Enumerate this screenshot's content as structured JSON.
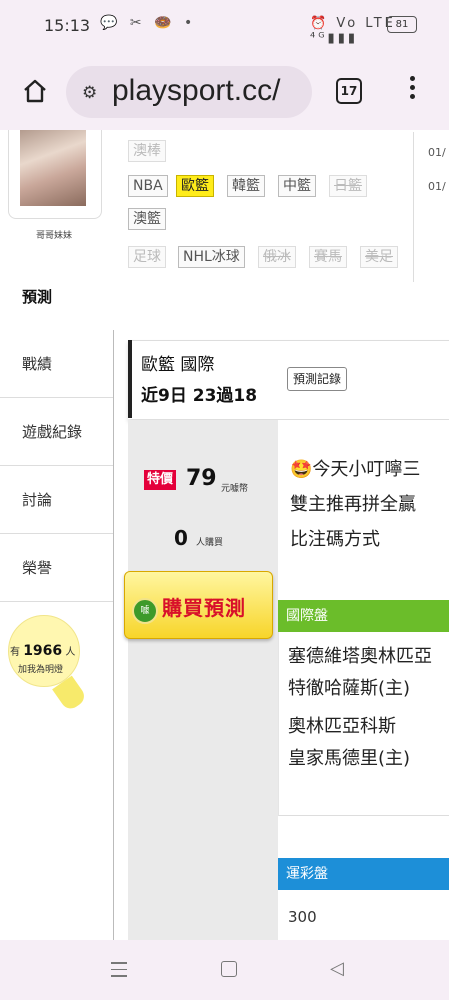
{
  "status_bar": {
    "time": "15:13",
    "left_icons": "💬 ✂ 🍩 •",
    "right_icons": "⏰ Vo LTE ⁴ᴳ▮▮▮",
    "battery": "81"
  },
  "browser": {
    "url": "playsport.cc/",
    "tab_count": "17",
    "home_icon": "home-icon",
    "menu_icon": "more-vert-icon"
  },
  "profile": {
    "name": "哥哥妹妹"
  },
  "sidebar": {
    "items": [
      {
        "label": "預測",
        "active": true
      },
      {
        "label": "戰績"
      },
      {
        "label": "遊戲紀錄"
      },
      {
        "label": "討論"
      },
      {
        "label": "榮譽"
      }
    ]
  },
  "fans": {
    "prefix": "有",
    "count": "1966",
    "suffix": "人",
    "line2": "加我為明燈"
  },
  "filters": {
    "row0": [
      "澳棒"
    ],
    "row1": [
      "NBA",
      "歐籃",
      "韓籃",
      "中籃",
      "日籃"
    ],
    "row2": [
      "澳籃"
    ],
    "row3": [
      "足球",
      "NHL冰球",
      "俄冰",
      "賽馬",
      "美足"
    ],
    "dates": [
      "01/",
      "01/"
    ]
  },
  "record": {
    "title": "歐籃 國際",
    "stat": "近9日 23過18",
    "history_button": "預測記錄"
  },
  "offer": {
    "badge": "特價",
    "price": "79",
    "price_unit": "元噱幣",
    "buyers": "0",
    "buyers_unit": "人購買",
    "buy_label": "購買預測",
    "coin_label": "噱"
  },
  "description": {
    "line1": "🤩今天小叮嚀三",
    "line2": "雙主推再拼全贏",
    "line3": "比注碼方式"
  },
  "intl_market": {
    "header": "國際盤",
    "games": [
      {
        "line1": "塞德維塔奧林匹亞",
        "line2": "特徹哈薩斯(主)"
      },
      {
        "line1": "奧林匹亞科斯",
        "line2": "皇家馬德里(主)"
      }
    ]
  },
  "lottery_market": {
    "header": "運彩盤",
    "value": "300"
  },
  "colors": {
    "accent_yellow": "#ffec1a",
    "intl_green": "#6bbd2a",
    "lottery_blue": "#1d8fd8",
    "special_red": "#e4003a"
  }
}
